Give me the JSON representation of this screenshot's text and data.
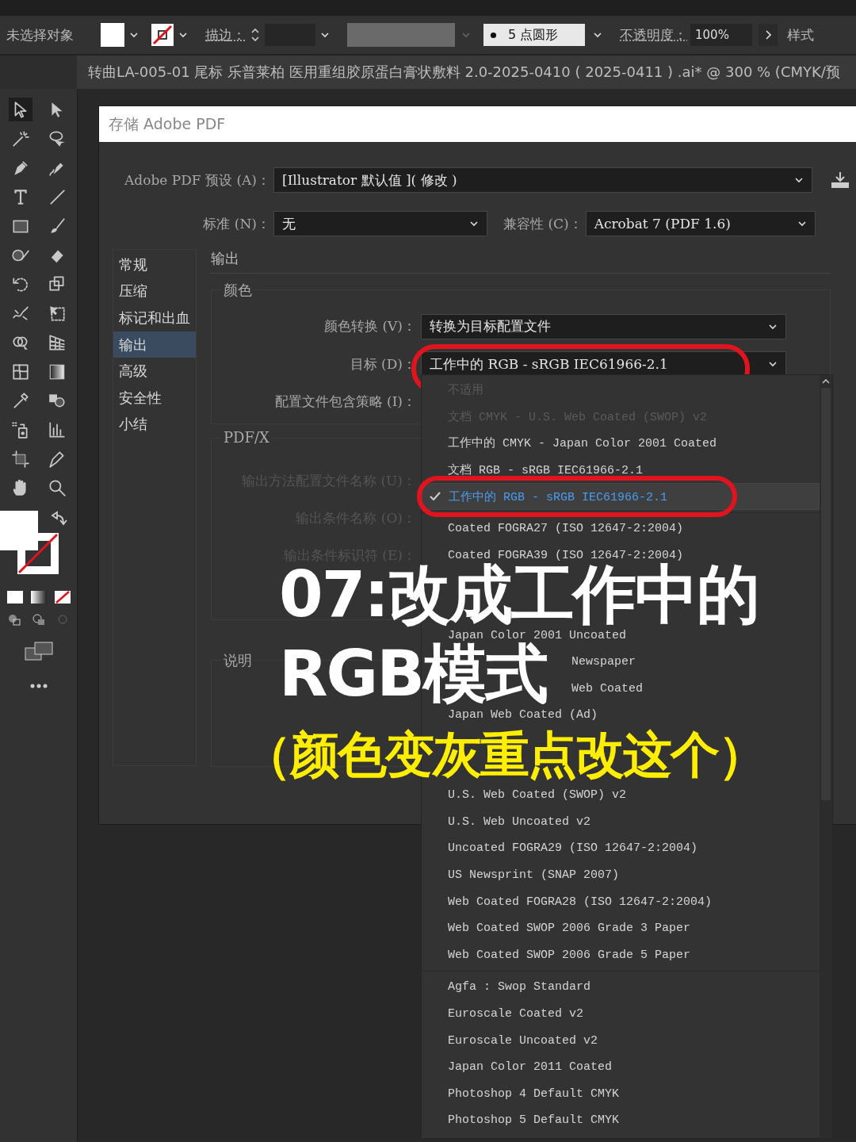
{
  "control_bar": {
    "selection": "未选择对象",
    "stroke_label": "描边：",
    "brush": "5 点圆形",
    "opacity_label": "不透明度：",
    "opacity": "100%",
    "style_label": "样式"
  },
  "document_tab": {
    "title": "转曲LA-005-01 尾标 乐普莱柏 医用重组胶原蛋白膏状敷料 2.0-2025-0410 ( 2025-0411 ) .ai* @ 300 % (CMYK/预"
  },
  "dialog": {
    "title": "存储 Adobe PDF",
    "preset": {
      "label": "Adobe PDF 预设 (A)：",
      "value": "[Illustrator 默认值 ]( 修改 )"
    },
    "standard": {
      "label": "标准 (N)：",
      "value": "无"
    },
    "compatibility": {
      "label": "兼容性 (C)：",
      "value": "Acrobat 7 (PDF 1.6)"
    },
    "sidebar": {
      "items": [
        {
          "label": "常规",
          "selected": false
        },
        {
          "label": "压缩",
          "selected": false
        },
        {
          "label": "标记和出血",
          "selected": false
        },
        {
          "label": "输出",
          "selected": true
        },
        {
          "label": "高级",
          "selected": false
        },
        {
          "label": "安全性",
          "selected": false
        },
        {
          "label": "小结",
          "selected": false
        }
      ]
    },
    "section_title": "输出",
    "color_group": {
      "legend": "颜色",
      "fields": [
        {
          "label": "颜色转换 (V)：",
          "value": "转换为目标配置文件",
          "circled": false
        },
        {
          "label": "目标 (D)：",
          "value": "工作中的 RGB - sRGB IEC61966-2.1",
          "circled": true
        },
        {
          "label": "配置文件包含策略 (I)："
        }
      ]
    },
    "pdfx_group": {
      "legend": "PDF/X",
      "fields": [
        {
          "label": "输出方法配置文件名称 (U)：",
          "disabled": true
        },
        {
          "label": "输出条件名称 (O)：",
          "disabled": true
        },
        {
          "label": "输出条件标识符 (E)：",
          "disabled": true
        }
      ]
    },
    "description_group": {
      "legend": "说明"
    }
  },
  "dropdown": {
    "groups": [
      {
        "items": [
          {
            "label": "不适用",
            "disabled": true,
            "selected": false,
            "circled": false
          },
          {
            "label": "文档 CMYK - U.S. Web Coated (SWOP) v2",
            "disabled": true,
            "selected": false,
            "circled": false
          },
          {
            "label": "工作中的 CMYK - Japan Color 2001 Coated",
            "disabled": false,
            "selected": false,
            "circled": false
          },
          {
            "label": "文档 RGB - sRGB IEC61966-2.1",
            "disabled": false,
            "selected": false,
            "circled": false
          },
          {
            "label": "工作中的 RGB - sRGB IEC61966-2.1",
            "disabled": false,
            "selected": true,
            "circled": true
          }
        ]
      },
      {
        "items": [
          {
            "label": "Coated FOGRA27 (ISO 12647-2:2004)",
            "disabled": false,
            "selected": false,
            "circled": false
          },
          {
            "label": "Coated FOGRA39 (ISO 12647-2:2004)",
            "disabled": false,
            "selected": false,
            "circled": false
          },
          {
            "kind": "covered"
          },
          {
            "kind": "covered"
          },
          {
            "label": "Japan Color 2001 Uncoated",
            "disabled": false,
            "selected": false,
            "circled": false
          },
          {
            "kind": "partial",
            "label": "Newspaper",
            "disabled": false,
            "selected": false,
            "circled": false
          },
          {
            "kind": "partial",
            "label": "Web Coated",
            "disabled": false,
            "selected": false,
            "circled": false
          },
          {
            "label": "Japan Web Coated (Ad)",
            "disabled": false,
            "selected": false,
            "circled": false
          },
          {
            "kind": "covered"
          },
          {
            "kind": "covered"
          },
          {
            "label": "U.S. Web Coated (SWOP) v2",
            "disabled": false,
            "selected": false,
            "circled": false
          },
          {
            "label": "U.S. Web Uncoated v2",
            "disabled": false,
            "selected": false,
            "circled": false
          },
          {
            "label": "Uncoated FOGRA29 (ISO 12647-2:2004)",
            "disabled": false,
            "selected": false,
            "circled": false
          },
          {
            "label": "US Newsprint (SNAP 2007)",
            "disabled": false,
            "selected": false,
            "circled": false
          },
          {
            "label": "Web Coated FOGRA28 (ISO 12647-2:2004)",
            "disabled": false,
            "selected": false,
            "circled": false
          },
          {
            "label": "Web Coated SWOP 2006 Grade 3 Paper",
            "disabled": false,
            "selected": false,
            "circled": false
          },
          {
            "label": "Web Coated SWOP 2006 Grade 5 Paper",
            "disabled": false,
            "selected": false,
            "circled": false
          }
        ]
      },
      {
        "items": [
          {
            "label": "Agfa : Swop Standard",
            "disabled": false,
            "selected": false,
            "circled": false
          },
          {
            "label": "Euroscale Coated v2",
            "disabled": false,
            "selected": false,
            "circled": false
          },
          {
            "label": "Euroscale Uncoated v2",
            "disabled": false,
            "selected": false,
            "circled": false
          },
          {
            "label": "Japan Color 2011 Coated",
            "disabled": false,
            "selected": false,
            "circled": false
          },
          {
            "label": "Photoshop 4 Default CMYK",
            "disabled": false,
            "selected": false,
            "circled": false
          },
          {
            "label": "Photoshop 5 Default CMYK",
            "disabled": false,
            "selected": false,
            "circled": false
          }
        ]
      }
    ]
  },
  "caption": {
    "title_lines": [
      "07:改成工作中的",
      "RGB模式"
    ],
    "note": "（颜色变灰重点改这个）"
  }
}
